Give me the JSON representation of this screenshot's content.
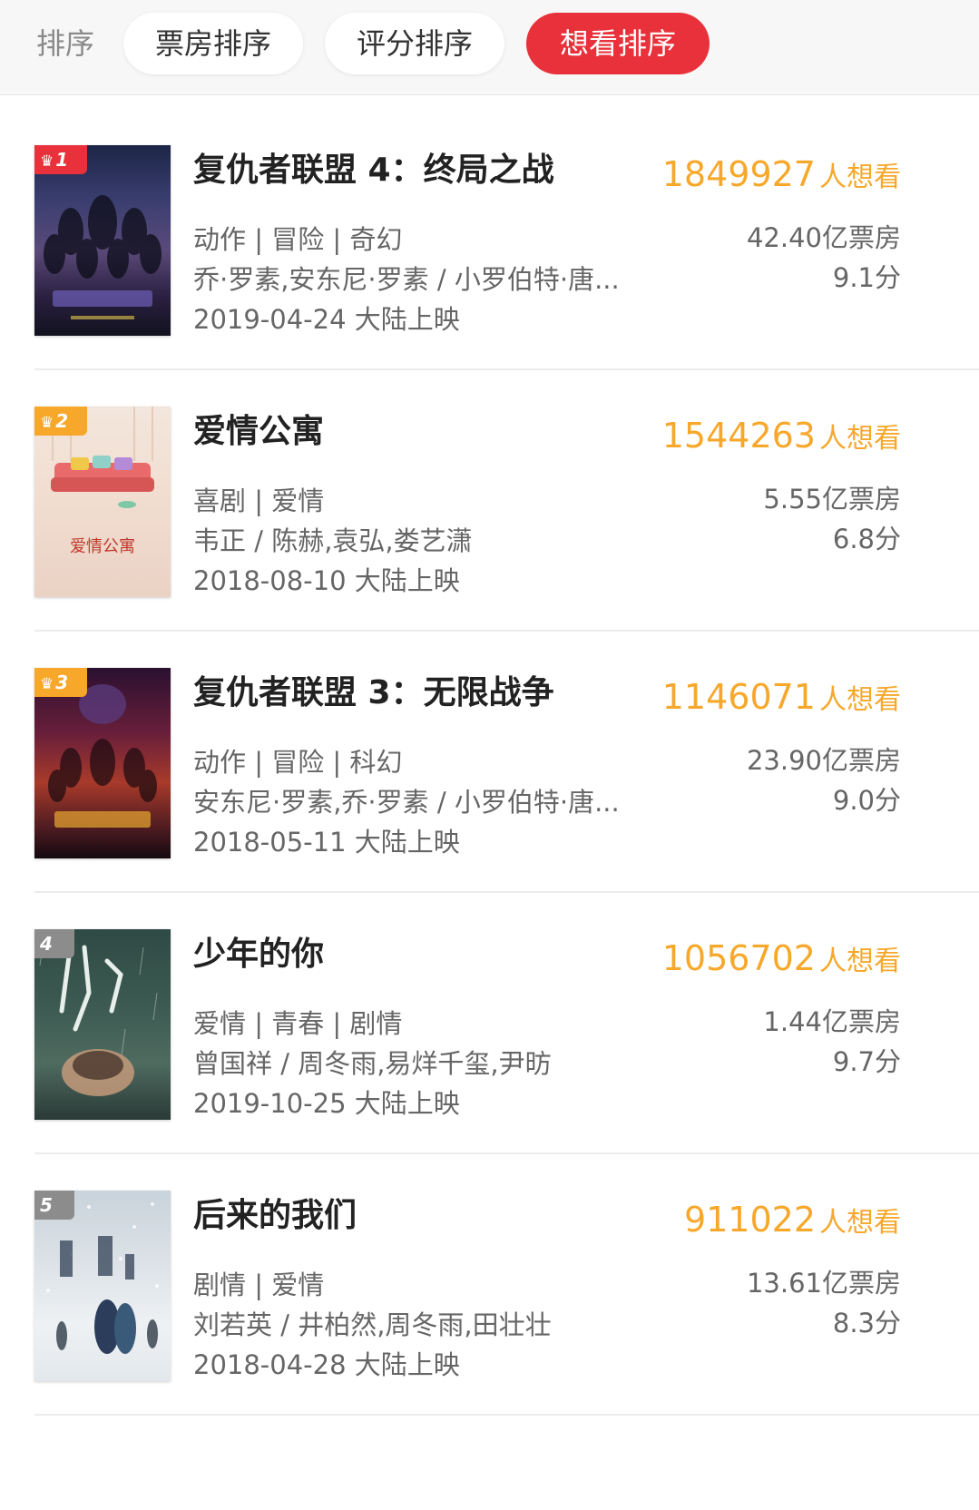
{
  "sort_bar": {
    "label": "排序",
    "buttons": [
      {
        "label": "票房排序",
        "active": false
      },
      {
        "label": "评分排序",
        "active": false
      },
      {
        "label": "想看排序",
        "active": true
      }
    ]
  },
  "colors": {
    "accent_red": "#e8313a",
    "want_orange": "#f7a82b",
    "badge_top3": "#f7a82b",
    "badge_rank1": "#e8313a",
    "badge_other": "#8c8c8c"
  },
  "movies": [
    {
      "rank": "1",
      "title": "复仇者联盟 4：终局之战",
      "want_count": "1849927",
      "want_suffix": "人想看",
      "genres": "动作 | 冒险 | 奇幻",
      "cast": "乔·罗素,安东尼·罗素 / 小罗伯特·唐...",
      "release": "2019-04-24 大陆上映",
      "box_office": "42.40亿票房",
      "score": "9.1分"
    },
    {
      "rank": "2",
      "title": "爱情公寓",
      "want_count": "1544263",
      "want_suffix": "人想看",
      "genres": "喜剧 | 爱情",
      "cast": "韦正 / 陈赫,袁弘,娄艺潇",
      "release": "2018-08-10 大陆上映",
      "box_office": "5.55亿票房",
      "score": "6.8分"
    },
    {
      "rank": "3",
      "title": "复仇者联盟 3：无限战争",
      "want_count": "1146071",
      "want_suffix": "人想看",
      "genres": "动作 | 冒险 | 科幻",
      "cast": "安东尼·罗素,乔·罗素 / 小罗伯特·唐...",
      "release": "2018-05-11 大陆上映",
      "box_office": "23.90亿票房",
      "score": "9.0分"
    },
    {
      "rank": "4",
      "title": "少年的你",
      "want_count": "1056702",
      "want_suffix": "人想看",
      "genres": "爱情 | 青春 | 剧情",
      "cast": "曾国祥 / 周冬雨,易烊千玺,尹昉",
      "release": "2019-10-25 大陆上映",
      "box_office": "1.44亿票房",
      "score": "9.7分"
    },
    {
      "rank": "5",
      "title": "后来的我们",
      "want_count": "911022",
      "want_suffix": "人想看",
      "genres": "剧情 | 爱情",
      "cast": "刘若英 / 井柏然,周冬雨,田壮壮",
      "release": "2018-04-28 大陆上映",
      "box_office": "13.61亿票房",
      "score": "8.3分"
    }
  ]
}
